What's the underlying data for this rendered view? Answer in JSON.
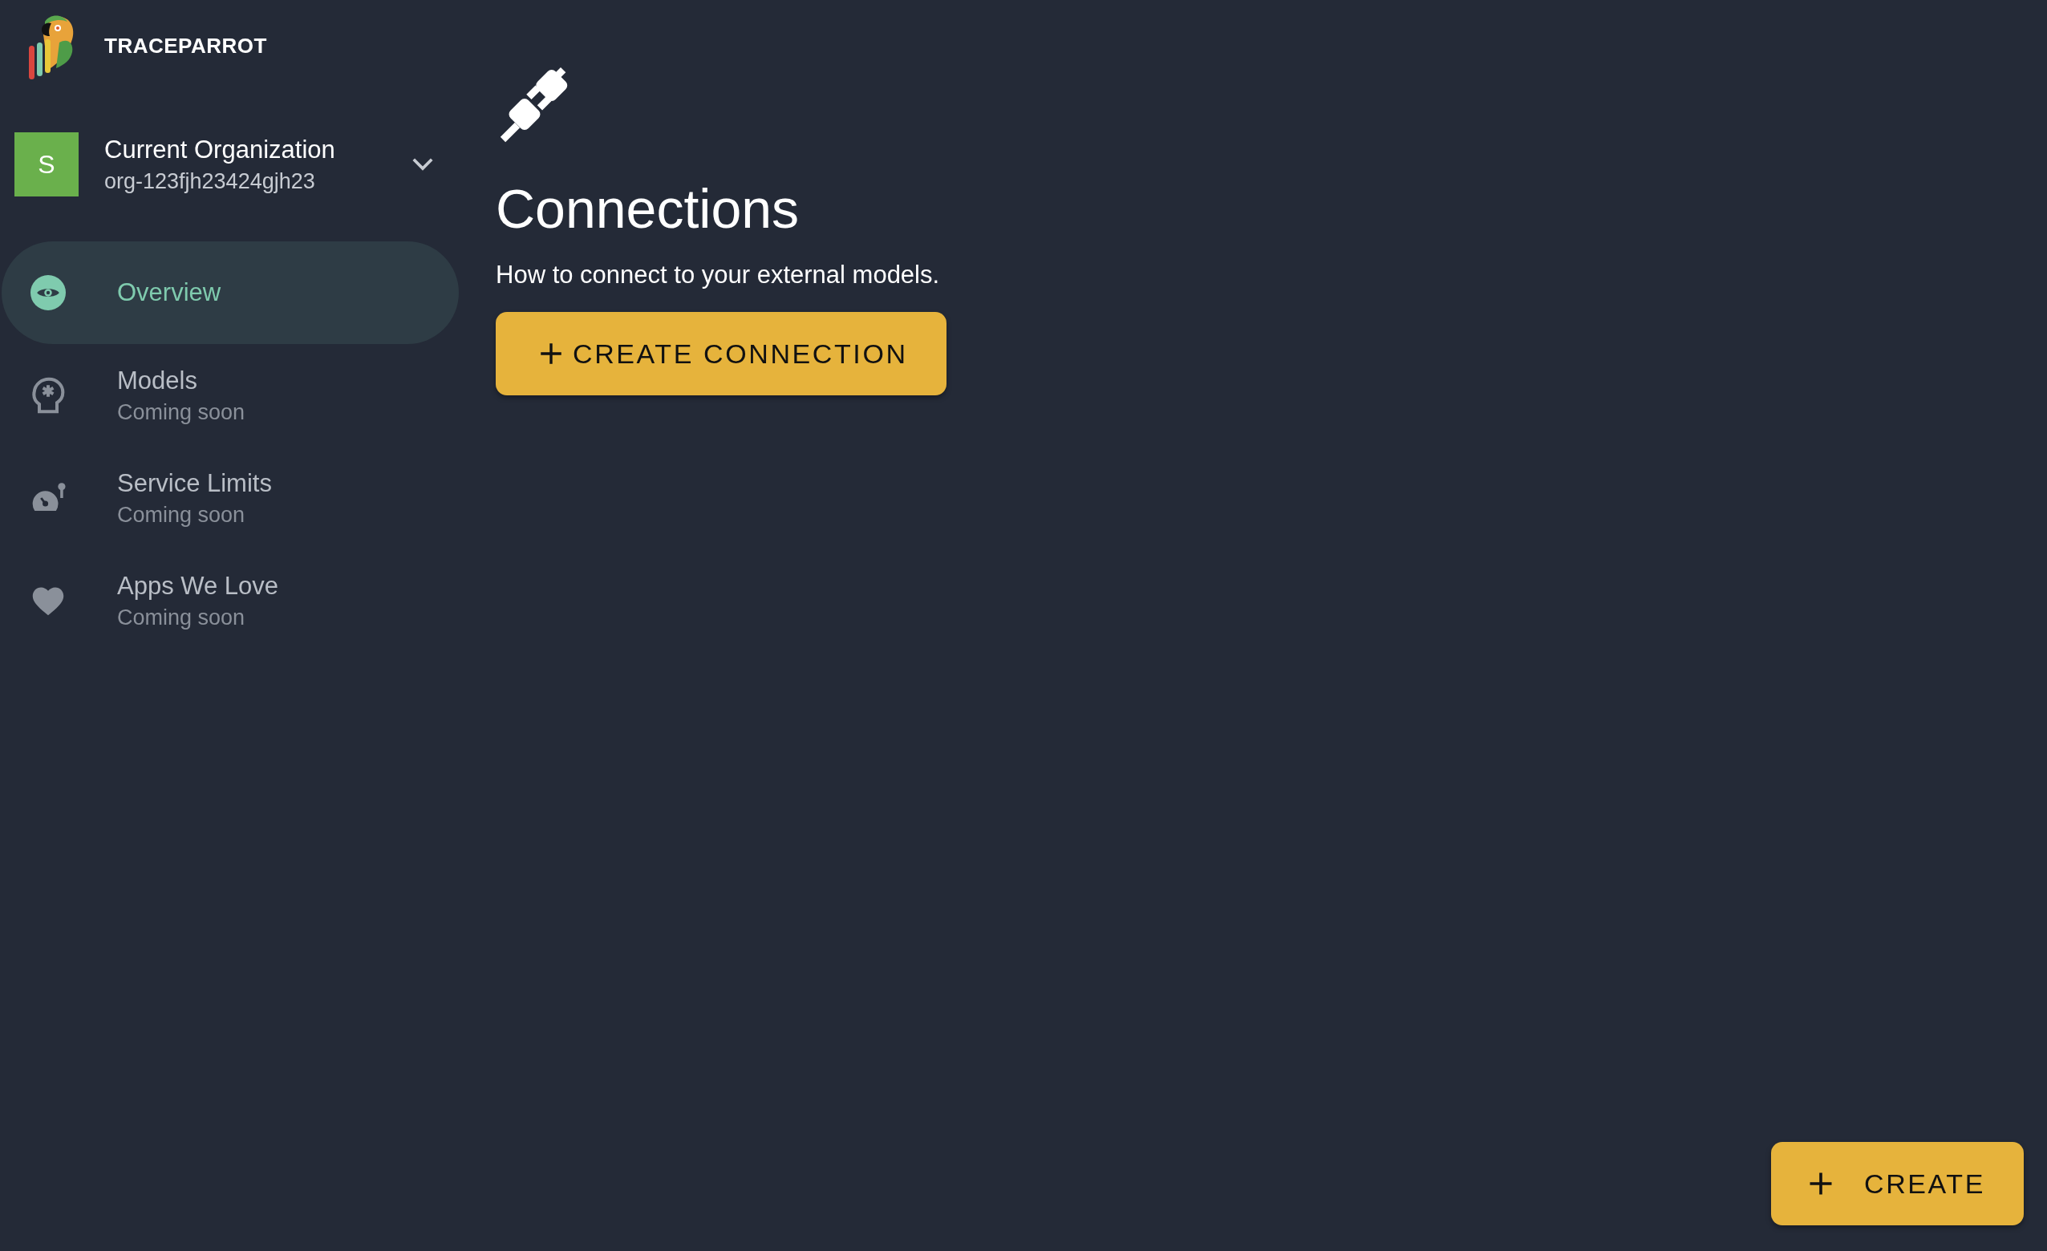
{
  "app": {
    "name": "TRACEPARROT"
  },
  "organization": {
    "avatar": "S",
    "title": "Current Organization",
    "id": "org-123fjh23424gjh23"
  },
  "nav": [
    {
      "label": "Overview",
      "selected": true
    },
    {
      "label": "Models",
      "subtitle": "Coming soon",
      "selected": false
    },
    {
      "label": "Service Limits",
      "subtitle": "Coming soon",
      "selected": false
    },
    {
      "label": "Apps We Love",
      "subtitle": "Coming soon",
      "selected": false
    }
  ],
  "page": {
    "title": "Connections",
    "description": "How to connect to your external models.",
    "button": "CREATE CONNECTION"
  },
  "fab": {
    "label": "CREATE"
  }
}
